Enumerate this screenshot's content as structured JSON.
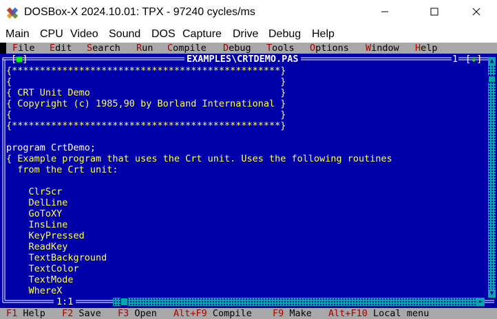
{
  "window": {
    "title": "DOSBox-X 2024.10.01: TPX - 97240 cycles/ms",
    "app_icon": "dosbox-icon",
    "controls": [
      "minimize-icon",
      "maximize-icon",
      "close-icon"
    ]
  },
  "host_menu": [
    "Main",
    "CPU",
    "Video",
    "Sound",
    "DOS",
    "Capture",
    "Drive",
    "Debug",
    "Help"
  ],
  "ide_menu": [
    {
      "hotkey": "F",
      "rest": "ile"
    },
    {
      "hotkey": "E",
      "rest": "dit"
    },
    {
      "hotkey": "S",
      "rest": "earch"
    },
    {
      "hotkey": "R",
      "rest": "un"
    },
    {
      "hotkey": "C",
      "rest": "ompile"
    },
    {
      "hotkey": "D",
      "rest": "ebug"
    },
    {
      "hotkey": "T",
      "rest": "ools"
    },
    {
      "hotkey": "O",
      "rest": "ptions"
    },
    {
      "hotkey": "W",
      "rest": "indow"
    },
    {
      "hotkey": "H",
      "rest": "elp"
    }
  ],
  "editor": {
    "filename": "EXAMPLES\\CRTDEMO.PAS",
    "window_number": "1",
    "close_box": "■",
    "zoom_box": "↕",
    "cursor_position": "1:1",
    "lines": [
      "{************************************************}",
      "{                                                }",
      "{ CRT Unit Demo                                  }",
      "{ Copyright (c) 1985,90 by Borland International }",
      "{                                                }",
      "{************************************************}",
      "",
      "program CrtDemo;",
      "{ Example program that uses the Crt unit. Uses the following routines",
      "  from the Crt unit:",
      "",
      "    ClrScr",
      "    DelLine",
      "    GoToXY",
      "    InsLine",
      "    KeyPressed",
      "    ReadKey",
      "    TextBackground",
      "    TextColor",
      "    TextMode",
      "    WhereX"
    ]
  },
  "status_bar": [
    {
      "key": "F1",
      "label": "Help"
    },
    {
      "key": "F2",
      "label": "Save"
    },
    {
      "key": "F3",
      "label": "Open"
    },
    {
      "key": "Alt+F9",
      "label": "Compile"
    },
    {
      "key": "F9",
      "label": "Make"
    },
    {
      "key": "Alt+F10",
      "label": "Local menu"
    }
  ],
  "colors": {
    "dos_blue": "#0000a8",
    "dos_gray": "#a8a8a8",
    "dos_red": "#a80000",
    "code_yellow": "#ffff55",
    "scroll_cyan": "#00a8a8"
  }
}
